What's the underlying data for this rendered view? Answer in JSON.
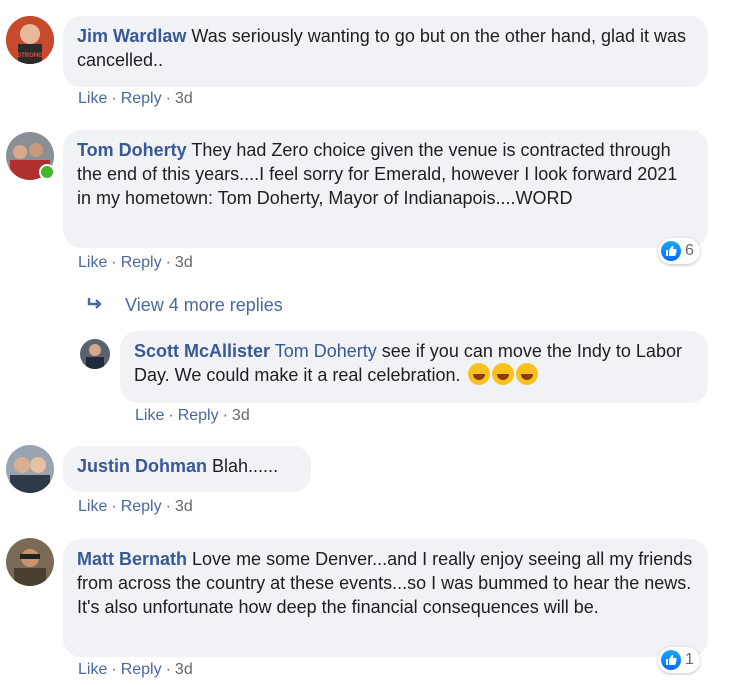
{
  "comments": [
    {
      "author": "Jim Wardlaw",
      "text": "Was seriously wanting to go but on the other hand, glad it was cancelled..",
      "actions": {
        "like": "Like",
        "reply": "Reply",
        "time": "3d"
      }
    },
    {
      "author": "Tom Doherty",
      "text": "They had Zero choice given the venue is contracted through the end of this years....I feel sorry for Emerald, however I look forward 2021 in my hometown: Tom Doherty, Mayor of Indianapois....WORD",
      "actions": {
        "like": "Like",
        "reply": "Reply",
        "time": "3d"
      },
      "reaction_count": "6",
      "view_more": "View 4 more replies",
      "reply": {
        "author": "Scott McAllister",
        "mention": "Tom Doherty",
        "text": "see if you can move the Indy to Labor Day. We could make it a real celebration.",
        "emojis": [
          "rofl-emoji",
          "rofl-emoji",
          "rofl-emoji"
        ],
        "actions": {
          "like": "Like",
          "reply": "Reply",
          "time": "3d"
        }
      }
    },
    {
      "author": "Justin Dohman",
      "text": "Blah......",
      "actions": {
        "like": "Like",
        "reply": "Reply",
        "time": "3d"
      }
    },
    {
      "author": "Matt Bernath",
      "text": "Love me some Denver...and I really enjoy seeing all my friends from across the country at these events...so I was bummed to hear the news. It's also unfortunate how deep the financial consequences will be.",
      "actions": {
        "like": "Like",
        "reply": "Reply",
        "time": "3d"
      },
      "reaction_count": "1"
    }
  ],
  "avatar_badge_text": "STRONG",
  "colors": {
    "bubble": "#f0f2f5",
    "author": "#385898",
    "action": "#4b67a1",
    "meta": "#65676b"
  }
}
